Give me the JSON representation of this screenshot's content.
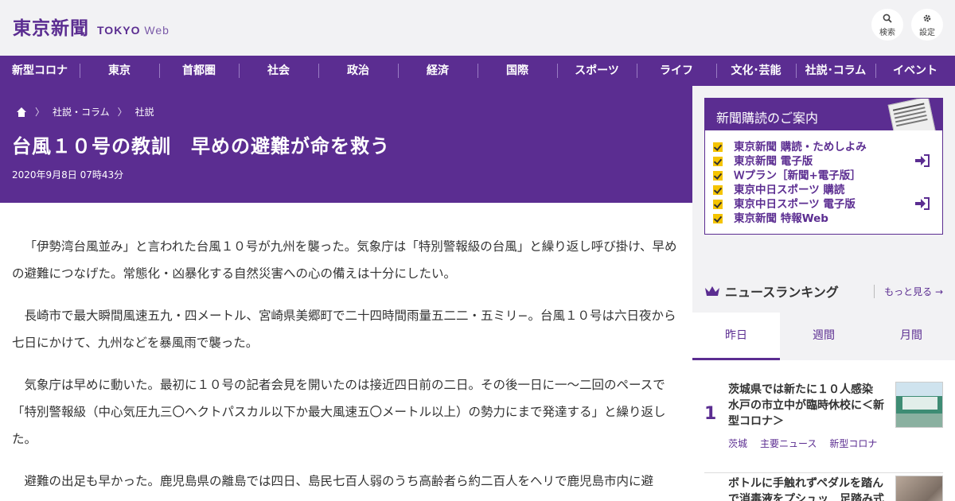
{
  "header": {
    "logo_jp": "東京新聞",
    "logo_en_bold": "TOKYO",
    "logo_en_light": "Web",
    "search_label": "検索",
    "settings_label": "設定"
  },
  "nav": {
    "items": [
      "新型コロナ",
      "東京",
      "首都圏",
      "社会",
      "政治",
      "経済",
      "国際",
      "スポーツ",
      "ライフ",
      "文化･芸能",
      "社説･コラム",
      "イベント"
    ]
  },
  "breadcrumb": {
    "items": [
      "社説・コラム",
      "社説"
    ]
  },
  "article": {
    "title": "台風１０号の教訓　早めの避難が命を救う",
    "date": "2020年9月8日 07時43分",
    "paragraphs": [
      "「伊勢湾台風並み」と言われた台風１０号が九州を襲った。気象庁は「特別警報級の台風」と繰り返し呼び掛け、早めの避難につなげた。常態化・凶暴化する自然災害への心の備えは十分にしたい。",
      "長崎市で最大瞬間風速五九・四メートル、宮崎県美郷町で二十四時間雨量五二二・五ミリ−。台風１０号は六日夜から七日にかけて、九州などを暴風雨で襲った。",
      "気象庁は早めに動いた。最初に１０号の記者会見を開いたのは接近四日前の二日。その後一日に一〜二回のペースで「特別警報級（中心気圧九三〇ヘクトパスカル以下か最大風速五〇メートル以上）の勢力にまで発達する」と繰り返した。",
      "避難の出足も早かった。鹿児島県の離島では四日、島民七百人弱のうち高齢者ら約二百人をヘリで鹿児島市内に避"
    ]
  },
  "subscription": {
    "heading": "新聞購読のご案内",
    "items": [
      "東京新聞 購読・ためしよみ",
      "東京新聞 電子版",
      "Ｗプラン［新聞+電子版］",
      "東京中日スポーツ 購読",
      "東京中日スポーツ 電子版",
      "東京新聞 特報Web"
    ]
  },
  "ranking": {
    "title": "ニュースランキング",
    "more": "もっと見る",
    "tabs": [
      "昨日",
      "週間",
      "月間"
    ],
    "active_tab": "昨日",
    "items": [
      {
        "rank": "1",
        "title": "茨城県では新たに１０人感染　水戸の市立中が臨時休校に＜新型コロナ＞",
        "tags": [
          "茨城",
          "主要ニュース",
          "新型コロナ"
        ]
      },
      {
        "rank": "",
        "title": "ボトルに手触れずペダルを踏んで消毒液をプシュッ　足踏み式"
      }
    ]
  },
  "colors": {
    "brand_purple": "#5b2d91",
    "check_yellow": "#f5c400",
    "background": "#f2f2f4"
  }
}
